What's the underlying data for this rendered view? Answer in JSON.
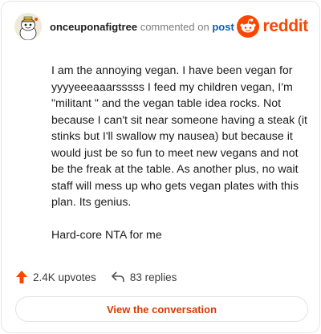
{
  "header": {
    "username": "onceuponafigtree",
    "action_text": "commented on",
    "post_link": "post",
    "brand": "reddit",
    "brand_color": "#ff4500"
  },
  "comment": {
    "paragraphs": [
      "I am the annoying vegan. I have been vegan for yyyyeeeaaarsssss I feed my children vegan, I'm \"militant \" and the vegan table idea rocks. Not because I can't sit near someone having a steak (it stinks but I'll swallow my nausea) but because it would just be so fun to meet new vegans and not be the freak at the table. As another plus, no wait staff will mess up who gets vegan plates with this plan. Its genius.",
      "Hard-core NTA for me"
    ]
  },
  "actions": {
    "upvotes": "2.4K upvotes",
    "replies": "83 replies"
  },
  "footer": {
    "view_button": "View the conversation"
  },
  "icons": {
    "avatar": "snoo-avatar-icon",
    "brand": "reddit-logo-icon",
    "upvote": "upvote-arrow-icon",
    "reply": "reply-arrow-icon"
  }
}
